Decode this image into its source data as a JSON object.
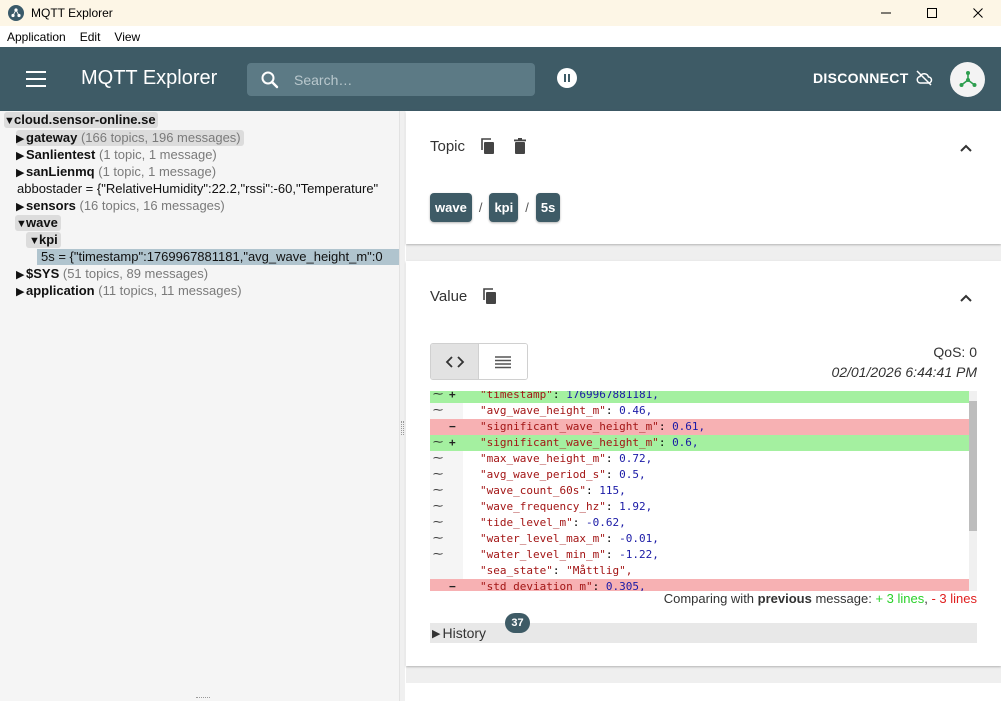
{
  "window": {
    "title": "MQTT Explorer"
  },
  "menu": [
    "Application",
    "Edit",
    "View"
  ],
  "appbar": {
    "title": "MQTT Explorer",
    "search_placeholder": "Search…",
    "disconnect_label": "DISCONNECT"
  },
  "tree": {
    "root": "cloud.sensor-online.se",
    "items": [
      {
        "caret": "▶",
        "name": "gateway",
        "meta": "(166 topics, 196 messages)"
      },
      {
        "caret": "▶",
        "name": "Sanlientest",
        "meta": "(1 topic, 1 message)"
      },
      {
        "caret": "▶",
        "name": "sanLienmq",
        "meta": "(1 topic, 1 message)"
      },
      {
        "caret": "",
        "name": "abbostader = {\"RelativeHumidity\":22.2,\"rssi\":-60,\"Temperature\"",
        "meta": ""
      },
      {
        "caret": "▶",
        "name": "sensors",
        "meta": "(16 topics, 16 messages)"
      },
      {
        "caret": "▼",
        "name": "wave",
        "meta": ""
      },
      {
        "caret": "▼",
        "name": "kpi",
        "meta": ""
      },
      {
        "caret": "",
        "name": "5s = {\"timestamp\":1769967881181,\"avg_wave_height_m\":0",
        "meta": ""
      },
      {
        "caret": "▶",
        "name": "$SYS",
        "meta": "(51 topics, 89 messages)"
      },
      {
        "caret": "▶",
        "name": "application",
        "meta": "(11 topics, 11 messages)"
      }
    ]
  },
  "topic_panel": {
    "label": "Topic",
    "breadcrumb": [
      "wave",
      "kpi",
      "5s"
    ],
    "separator": "/"
  },
  "value_panel": {
    "label": "Value",
    "qos": "QoS: 0",
    "timestamp": "02/01/2026 6:44:41 PM",
    "diff_lines": [
      {
        "type": "add",
        "g1": "⁓",
        "g2": "+",
        "key": "\"timestamp\"",
        "value": "1769967881181,"
      },
      {
        "type": "same",
        "g1": "⁓",
        "g2": "",
        "key": "\"avg_wave_height_m\"",
        "value": "0.46,"
      },
      {
        "type": "del",
        "g1": "",
        "g2": "−",
        "key": "\"significant_wave_height_m\"",
        "value": "0.61,"
      },
      {
        "type": "add",
        "g1": "⁓",
        "g2": "+",
        "key": "\"significant_wave_height_m\"",
        "value": "0.6,"
      },
      {
        "type": "same",
        "g1": "⁓",
        "g2": "",
        "key": "\"max_wave_height_m\"",
        "value": "0.72,"
      },
      {
        "type": "same",
        "g1": "⁓",
        "g2": "",
        "key": "\"avg_wave_period_s\"",
        "value": "0.5,"
      },
      {
        "type": "same",
        "g1": "⁓",
        "g2": "",
        "key": "\"wave_count_60s\"",
        "value": "115,"
      },
      {
        "type": "same",
        "g1": "⁓",
        "g2": "",
        "key": "\"wave_frequency_hz\"",
        "value": "1.92,"
      },
      {
        "type": "same",
        "g1": "⁓",
        "g2": "",
        "key": "\"tide_level_m\"",
        "value": "-0.62,"
      },
      {
        "type": "same",
        "g1": "⁓",
        "g2": "",
        "key": "\"water_level_max_m\"",
        "value": "-0.01,"
      },
      {
        "type": "same",
        "g1": "⁓",
        "g2": "",
        "key": "\"water_level_min_m\"",
        "value": "-1.22,"
      },
      {
        "type": "same",
        "g1": "",
        "g2": "",
        "key": "\"sea_state\"",
        "value": "\"Måttlig\","
      },
      {
        "type": "del",
        "g1": "",
        "g2": "−",
        "key": "\"std_deviation_m\"",
        "value": "0.305,"
      }
    ],
    "compare": {
      "prefix": "Comparing with ",
      "bold": "previous",
      "suffix": " message: ",
      "added": "+ 3 lines",
      "sep": ", ",
      "removed": "- 3 lines"
    },
    "history_label": "History",
    "history_count": "37"
  },
  "colors": {
    "appbar": "#3e5b66",
    "diff_add": "#a4f0a0",
    "diff_del": "#f7b1b3"
  }
}
